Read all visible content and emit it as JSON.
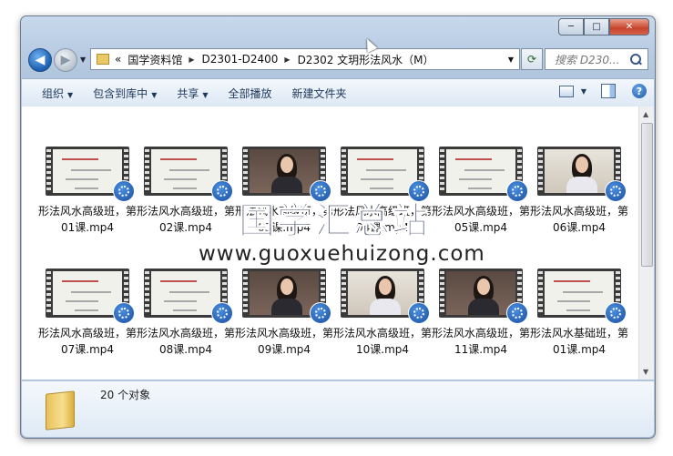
{
  "window": {
    "caption_buttons": {
      "minimize": "─",
      "maximize": "□",
      "close": "✕"
    }
  },
  "nav": {
    "back_glyph": "◀",
    "forward_glyph": "▶",
    "breadcrumbs": [
      "国学资料馆",
      "D2301-D2400",
      "D2302 文玥形法风水（M）"
    ],
    "leading_chevron": "«",
    "search_placeholder": "搜索 D230..."
  },
  "toolbar": {
    "organize": "组织",
    "include_library": "包含到库中",
    "share": "共享",
    "play_all": "全部播放",
    "new_folder": "新建文件夹",
    "help": "?"
  },
  "files": [
    {
      "name": "形法风水高级班，第01课.mp4",
      "thumb": "slide"
    },
    {
      "name": "形法风水高级班，第02课.mp4",
      "thumb": "slide"
    },
    {
      "name": "形法风水高级班，第03课.mp4",
      "thumb": "person"
    },
    {
      "name": "形法风水高级班，第04课.mp4",
      "thumb": "slide"
    },
    {
      "name": "形法风水高级班，第05课.mp4",
      "thumb": "slide"
    },
    {
      "name": "形法风水高级班，第06课.mp4",
      "thumb": "person-light"
    },
    {
      "name": "形法风水高级班，第07课.mp4",
      "thumb": "slide"
    },
    {
      "name": "形法风水高级班，第08课.mp4",
      "thumb": "slide"
    },
    {
      "name": "形法风水高级班，第09课.mp4",
      "thumb": "person"
    },
    {
      "name": "形法风水高级班，第10课.mp4",
      "thumb": "person-light"
    },
    {
      "name": "形法风水高级班，第11课.mp4",
      "thumb": "person"
    },
    {
      "name": "形法风水基础班，第01课.mp4",
      "thumb": "slide"
    }
  ],
  "status": {
    "item_count": "20 个对象"
  },
  "watermark": {
    "cn": "国学汇总站",
    "url": "www.guoxuehuizong.com"
  },
  "colors": {
    "accent": "#1a5fb0",
    "toolbar_text": "#1e395b"
  }
}
